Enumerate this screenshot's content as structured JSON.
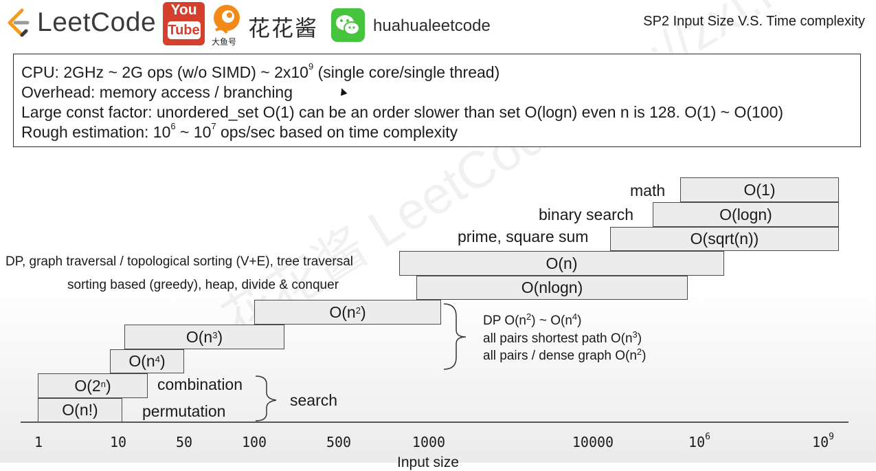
{
  "header": {
    "brand": "LeetCode",
    "youtube_top": "You",
    "youtube_bottom": "Tube",
    "fish_caption": "大鱼号",
    "channel_cn": "花花酱",
    "wechat_name": "huahualeetcode",
    "slide_title": "SP2 Input Size V.S. Time complexity"
  },
  "info": {
    "line1_pre": "CPU: 2GHz ~ 2G ops (w/o SIMD) ~ 2x10",
    "line1_sup": "9",
    "line1_post": " (single core/single thread)",
    "line2": "Overhead: memory access / branching",
    "line3": "Large const factor: unordered_set O(1) can be an order slower than set O(logn) even n is 128. O(1) ~ O(100)",
    "line4_a": "Rough estimation: 10",
    "line4_sup1": "6",
    "line4_b": " ~ 10",
    "line4_sup2": "7",
    "line4_c": " ops/sec based on time complexity"
  },
  "bars": {
    "o1": "O(1)",
    "ologn": "O(logn)",
    "osqrt": "O(sqrt(n))",
    "on": "O(n)",
    "onlogn": "O(nlogn)",
    "on2_base": "O(n",
    "on2_sup": "2",
    "on3_base": "O(n",
    "on3_sup": "3",
    "on4_base": "O(n",
    "on4_sup": "4",
    "o2n_base": "O(2",
    "o2n_sup": "n",
    "ofact": "O(n!)",
    "close": ")"
  },
  "labels": {
    "math": "math",
    "binary_search": "binary search",
    "prime": "prime, square sum",
    "dp_graph": "DP, graph traversal / topological sorting (V+E), tree traversal",
    "sorting": "sorting based (greedy), heap, divide & conquer",
    "combination": "combination",
    "permutation": "permutation",
    "search": "search",
    "dp_note_a": "DP O(n",
    "dp_note_sup1": "2",
    "dp_note_b": ") ~ O(n",
    "dp_note_sup2": "4",
    "dp_note_c": ")",
    "apsp_a": "all pairs shortest path O(n",
    "apsp_sup": "3",
    "apsp_c": ")",
    "dense_a": "all pairs / dense graph O(n",
    "dense_sup": "2",
    "dense_c": ")"
  },
  "axis": {
    "ticks": [
      "1",
      "10",
      "50",
      "100",
      "500",
      "1000",
      "10000",
      "10",
      "10"
    ],
    "tick_sup_6": "6",
    "tick_sup_9": "9",
    "xlabel": "Input size"
  },
  "watermark": "花花酱 LeetCode  http://zxi.mytechroad.com/blog/"
}
